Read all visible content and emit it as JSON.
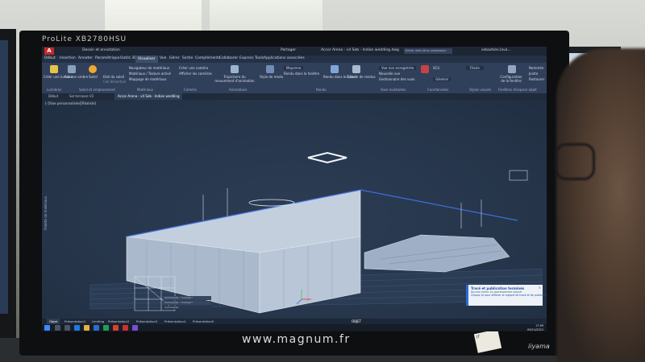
{
  "monitor": {
    "brand": "ProLite XB2780HSU",
    "maker": "iiyama",
    "sticker": "IT"
  },
  "titlebar": {
    "tabs": [
      "Dessin et annotation",
      "Partager"
    ],
    "title": "Accor Arena - v4 Seb - Indian wedding.dwg",
    "search_placeholder": "Entrer mot-clé ou expression",
    "user": "sebastien.lava..."
  },
  "menu": {
    "tabs": [
      "Début",
      "Insertion",
      "Annoter",
      "Paramétrique",
      "Outils 3D",
      "Visualiser",
      "Vue",
      "Gérer",
      "Sortie",
      "Compléments",
      "Collaborer",
      "Express Tools",
      "Applications associées"
    ],
    "active": "Visualiser"
  },
  "ribbon": {
    "lumieres": [
      "Créer une lumière",
      "Aucune ombre",
      "Soleil"
    ],
    "soleil": [
      "Etat du soleil",
      "Ciel désactivé"
    ],
    "materiaux": [
      "Navigateur de matériaux",
      "Matériaux / Texture activé",
      "Mappage de matériaux"
    ],
    "camera": [
      "Créer une caméra",
      "Afficher les caméras"
    ],
    "animations": "Trajectoire du mouvement d'animation",
    "rendu": [
      "Style de rendu",
      "Moyenne",
      "Rendu dans la fenêtre",
      "Rendu dans le Cloud",
      "Galerie de rendus"
    ],
    "vues": [
      "Vue non enregistrée",
      "Nouvelle vue",
      "Gestionnaire des vues"
    ],
    "coordonnees": [
      "SCU",
      "Général"
    ],
    "styles": "Filaire",
    "fenetres": [
      "Configuration de la fenêtre",
      "Nommée",
      "Jointe",
      "Restaurer"
    ],
    "panels": [
      "Lumières",
      "Soleil et emplacement",
      "Matériaux",
      "Caméra",
      "Animations",
      "Rendu",
      "Vues existantes",
      "Coordonnées",
      "Styles visuels",
      "Fenêtres d'espace objet"
    ]
  },
  "doc_tabs": [
    "Début",
    "Sol terrasse V2",
    "Accor Arena - v4 Seb - Indian wedding"
  ],
  "viewport": {
    "label": "[-][Vue personnalisée][Réaliste]",
    "side_label": "Palette de matériaux"
  },
  "command_line": [
    "Commande : *Annuler*",
    "Commande : *Annuler*",
    "Commande"
  ],
  "notification": {
    "title": "Tracé et publication terminés",
    "line1": "Aucune erreur ou avertissement trouvé",
    "line2": "Cliquez ici pour afficher le rapport de tracé et de publication"
  },
  "layout_tabs": [
    "Objet",
    "Présentation1",
    "Limiting",
    "Présentation2",
    "Présentation3",
    "Présentation4",
    "Présentation5"
  ],
  "status": {
    "mode": "OBJET"
  },
  "clock": {
    "time": "17:09",
    "date": "09/11/2021"
  },
  "watermark": "www.magnum.fr",
  "colors": {
    "viewport_bg": "#27364a",
    "ribbon_bg": "#30405a",
    "accent": "#2a6dd6",
    "app_red": "#c62828"
  }
}
